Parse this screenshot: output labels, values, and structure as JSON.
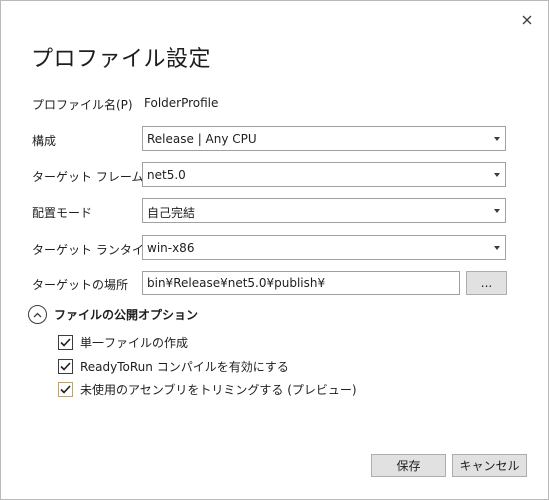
{
  "dialog": {
    "title": "プロファイル設定",
    "close_icon": "close-icon"
  },
  "profile_name": {
    "label": "プロファイル名(P)",
    "value": "FolderProfile"
  },
  "configuration": {
    "label": "構成",
    "value": "Release | Any CPU"
  },
  "target_framework": {
    "label": "ターゲット フレームワーク",
    "value": "net5.0"
  },
  "deployment_mode": {
    "label": "配置モード",
    "value": "自己完結"
  },
  "target_runtime": {
    "label": "ターゲット ランタイム",
    "value": "win-x86"
  },
  "target_location": {
    "label": "ターゲットの場所",
    "value": "bin¥Release¥net5.0¥publish¥",
    "browse_label": "..."
  },
  "publish_options": {
    "header": "ファイルの公開オプション",
    "expanded": true,
    "options": [
      {
        "label": "単一ファイルの作成",
        "checked": true
      },
      {
        "label": "ReadyToRun コンパイルを有効にする",
        "checked": true
      },
      {
        "label": "未使用のアセンブリをトリミングする (プレビュー)",
        "checked": true,
        "focused": true
      }
    ]
  },
  "buttons": {
    "save": "保存",
    "cancel": "キャンセル"
  },
  "colors": {
    "border": "#a0a0a0",
    "button_bg": "#e1e1e1",
    "focus_border": "#c8a24c"
  }
}
